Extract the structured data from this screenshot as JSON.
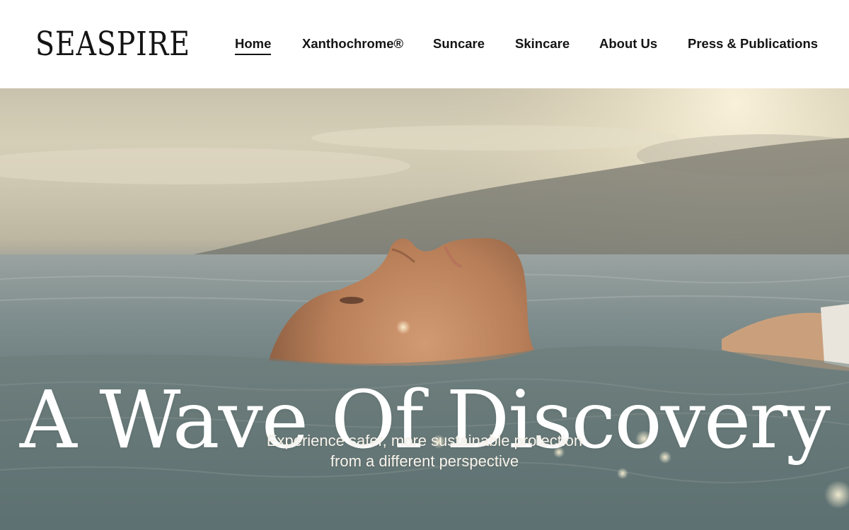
{
  "brand": {
    "logo_text": "SEASPIRE"
  },
  "nav": {
    "items": [
      {
        "label": "Home",
        "active": true
      },
      {
        "label": "Xanthochrome®",
        "active": false
      },
      {
        "label": "Suncare",
        "active": false
      },
      {
        "label": "Skincare",
        "active": false
      },
      {
        "label": "About Us",
        "active": false
      },
      {
        "label": "Press & Publications",
        "active": false
      }
    ]
  },
  "hero": {
    "title": "A Wave Of Discovery",
    "subtitle_line1": "Experience safer, more sustainable protection",
    "subtitle_line2": "from a different perspective",
    "image": "woman-floating-in-ocean-photo"
  },
  "colors": {
    "text_dark": "#141414",
    "hero_text": "#ffffff",
    "header_bg": "#ffffff"
  }
}
